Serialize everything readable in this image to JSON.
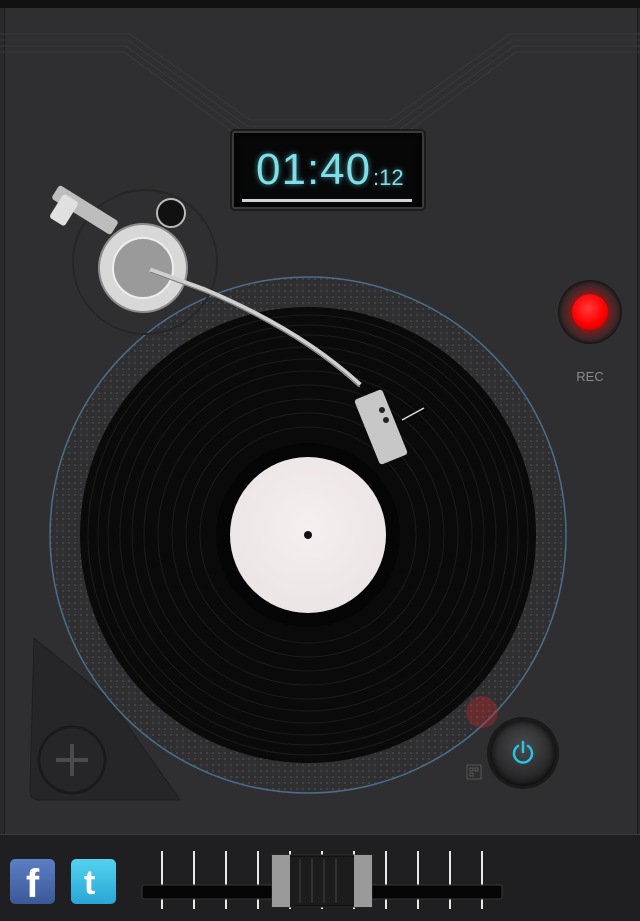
{
  "timer": {
    "main": "01:40",
    "fraction": ":12"
  },
  "record": {
    "label": "REC"
  },
  "social": {
    "facebook": "f",
    "twitter": "t"
  },
  "crossfader": {
    "position": 0.5
  },
  "colors": {
    "timer_digits": "#7fdfe9",
    "rec_light": "#ff0000",
    "power_icon": "#25c4e8",
    "facebook": "#3b5998",
    "twitter": "#2aa6d6"
  },
  "icons": [
    "add-icon",
    "power-icon",
    "grid-icon",
    "facebook-icon",
    "twitter-icon",
    "tonearm-icon",
    "vinyl-record-icon"
  ]
}
